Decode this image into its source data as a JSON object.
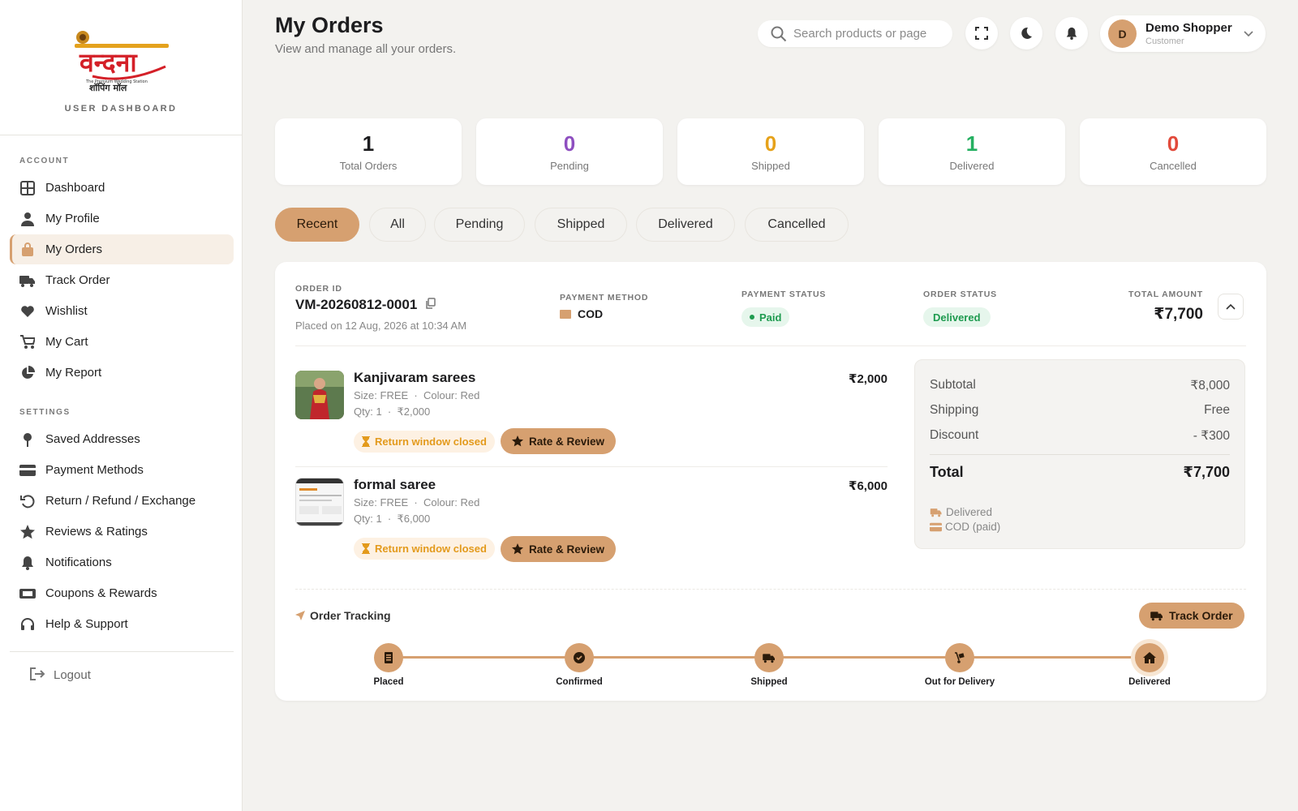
{
  "brand": {
    "logo_text": "वन्दना",
    "tagline": "The Premium Wedding Station",
    "sub_logo": "शॉपिंग मॉल",
    "dashboard_label": "USER DASHBOARD"
  },
  "sidebar": {
    "account_heading": "ACCOUNT",
    "account_items": [
      {
        "label": "Dashboard",
        "icon": "grid-icon"
      },
      {
        "label": "My Profile",
        "icon": "user-icon"
      },
      {
        "label": "My Orders",
        "icon": "bag-icon",
        "active": true
      },
      {
        "label": "Track Order",
        "icon": "truck-icon"
      },
      {
        "label": "Wishlist",
        "icon": "heart-icon"
      },
      {
        "label": "My Cart",
        "icon": "cart-icon"
      },
      {
        "label": "My Report",
        "icon": "pie-icon"
      }
    ],
    "settings_heading": "SETTINGS",
    "settings_items": [
      {
        "label": "Saved Addresses",
        "icon": "pin-icon"
      },
      {
        "label": "Payment Methods",
        "icon": "card-icon"
      },
      {
        "label": "Return / Refund / Exchange",
        "icon": "undo-icon"
      },
      {
        "label": "Reviews & Ratings",
        "icon": "star-icon"
      },
      {
        "label": "Notifications",
        "icon": "bell-icon"
      },
      {
        "label": "Coupons & Rewards",
        "icon": "ticket-icon"
      },
      {
        "label": "Help & Support",
        "icon": "headset-icon"
      }
    ],
    "logout": "Logout"
  },
  "header": {
    "title": "My Orders",
    "subtitle": "View and manage all your orders.",
    "search_placeholder": "Search products or page",
    "user": {
      "initial": "D",
      "name": "Demo Shopper",
      "role": "Customer"
    }
  },
  "stats": [
    {
      "value": "1",
      "label": "Total Orders",
      "color": "#1d1d1f"
    },
    {
      "value": "0",
      "label": "Pending",
      "color": "#8e4fc0"
    },
    {
      "value": "0",
      "label": "Shipped",
      "color": "#e6a21a"
    },
    {
      "value": "1",
      "label": "Delivered",
      "color": "#25b061"
    },
    {
      "value": "0",
      "label": "Cancelled",
      "color": "#e24a3b"
    }
  ],
  "tabs": [
    "Recent",
    "All",
    "Pending",
    "Shipped",
    "Delivered",
    "Cancelled"
  ],
  "order": {
    "id_label": "ORDER ID",
    "id": "VM-20260812-0001",
    "placed": "Placed on 12 Aug, 2026 at 10:34 AM",
    "payment_method_label": "PAYMENT METHOD",
    "payment_method": "COD",
    "payment_status_label": "PAYMENT STATUS",
    "payment_status": "Paid",
    "order_status_label": "ORDER STATUS",
    "order_status": "Delivered",
    "total_label": "TOTAL AMOUNT",
    "total": "₹7,700",
    "items": [
      {
        "title": "Kanjivaram sarees",
        "size": "Size: FREE",
        "colour": "Colour: Red",
        "qty": "Qty: 1",
        "unit": "₹2,000",
        "price": "₹2,000",
        "return_note": "Return window closed",
        "review": "Rate & Review"
      },
      {
        "title": "formal saree",
        "size": "Size: FREE",
        "colour": "Colour: Red",
        "qty": "Qty: 1",
        "unit": "₹6,000",
        "price": "₹6,000",
        "return_note": "Return window closed",
        "review": "Rate & Review"
      }
    ],
    "summary": {
      "subtotal_label": "Subtotal",
      "subtotal": "₹8,000",
      "shipping_label": "Shipping",
      "shipping": "Free",
      "discount_label": "Discount",
      "discount": "- ₹300",
      "total_label": "Total",
      "total": "₹7,700",
      "status_note": "Delivered",
      "payment_note": "COD (paid)"
    },
    "tracking": {
      "title": "Order Tracking",
      "button": "Track Order",
      "steps": [
        "Placed",
        "Confirmed",
        "Shipped",
        "Out for Delivery",
        "Delivered"
      ]
    }
  },
  "colors": {
    "accent": "#d6a070",
    "accent_soft": "#f7efe6",
    "success": "#1f9b50",
    "warning": "#e39a1c"
  }
}
